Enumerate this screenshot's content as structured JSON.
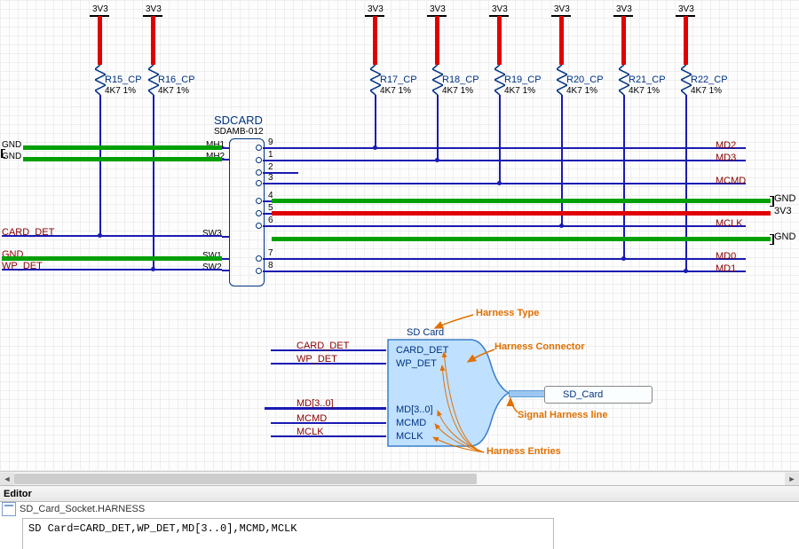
{
  "editor_title": "Editor",
  "file_name": "SD_Card_Socket.HARNESS",
  "console_line": "SD Card=CARD_DET,WP_DET,MD[3..0],MCMD,MCLK",
  "component": {
    "ref": "SDCARD",
    "part": "SDAMB-012",
    "pins_left": [
      {
        "name": "MH1",
        "num": ""
      },
      {
        "name": "MH2",
        "num": ""
      },
      {
        "name": "SW3",
        "num": ""
      },
      {
        "name": "SW1",
        "num": ""
      },
      {
        "name": "SW2",
        "num": ""
      }
    ],
    "pins_right_nums": [
      "9",
      "1",
      "2",
      "3",
      "4",
      "5",
      "6",
      "7",
      "8"
    ]
  },
  "power_label": "3V3",
  "resistors": [
    {
      "ref": "R15_CP",
      "value": "4K7 1%"
    },
    {
      "ref": "R16_CP",
      "value": "4K7 1%"
    },
    {
      "ref": "R17_CP",
      "value": "4K7 1%"
    },
    {
      "ref": "R18_CP",
      "value": "4K7 1%"
    },
    {
      "ref": "R19_CP",
      "value": "4K7 1%"
    },
    {
      "ref": "R20_CP",
      "value": "4K7 1%"
    },
    {
      "ref": "R21_CP",
      "value": "4K7 1%"
    },
    {
      "ref": "R22_CP",
      "value": "4K7 1%"
    }
  ],
  "nets_left": [
    "GND",
    "GND",
    "CARD_DET",
    "GND",
    "WP_DET"
  ],
  "nets_right_top": [
    "MD2",
    "MD3",
    "MCMD"
  ],
  "nets_right_mid": [
    "GND",
    "3V3",
    "MCLK",
    "GND"
  ],
  "nets_right_bot": [
    "MD0",
    "MD1"
  ],
  "harness": {
    "type_label": "SD Card",
    "entries": [
      "CARD_DET",
      "WP_DET",
      "MD[3..0]",
      "MCMD",
      "MCLK"
    ],
    "port_label": "SD_Card"
  },
  "harness_wire_labels": [
    "CARD_DET",
    "WP_DET",
    "MD[3..0]",
    "MCMD",
    "MCLK"
  ],
  "annotations": {
    "harness_type": "Harness Type",
    "harness_connector": "Harness Connector",
    "signal_harness_line": "Signal Harness line",
    "harness_entries": "Harness Entries"
  }
}
